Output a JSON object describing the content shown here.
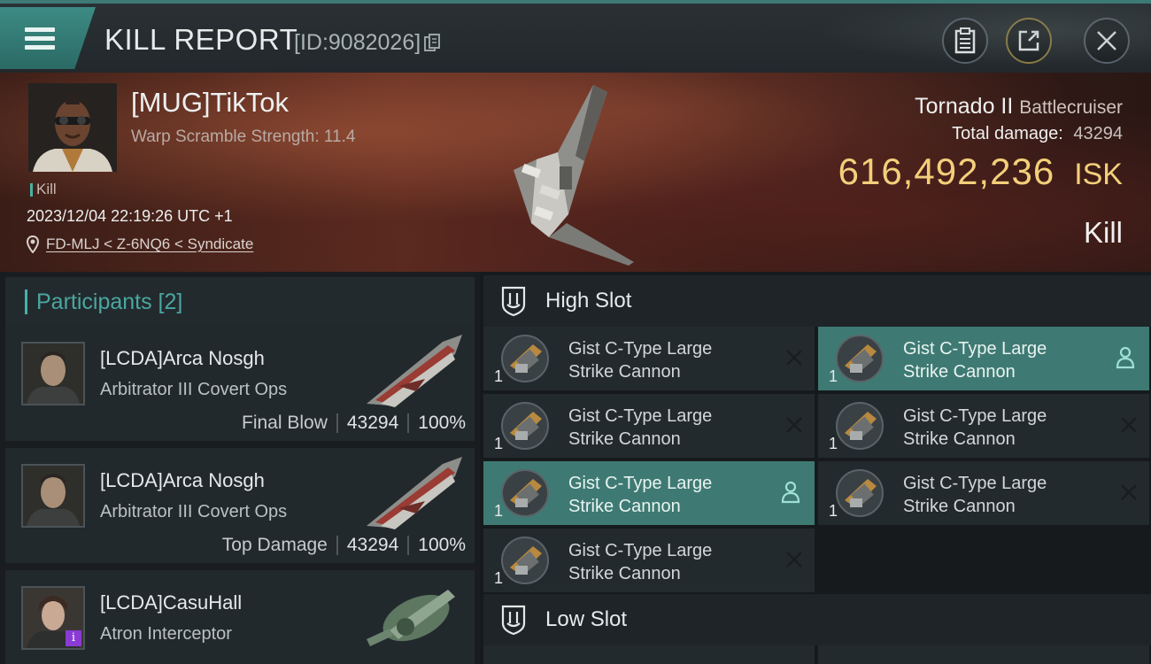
{
  "header": {
    "title": "KILL REPORT",
    "report_id": "[ID:9082026]",
    "icons": {
      "menu": "hamburger-menu-icon",
      "copy": "copy-icon",
      "clipboard": "clipboard-icon",
      "share": "share-icon",
      "close": "close-icon"
    }
  },
  "victim": {
    "name": "[MUG]TikTok",
    "subtitle": "Warp Scramble Strength: 11.4",
    "tag": "Kill",
    "timestamp": "2023/12/04 22:19:26 UTC +1",
    "location": "FD-MLJ < Z-6NQ6 < Syndicate",
    "ship_name": "Tornado II",
    "ship_class": "Battlecruiser",
    "total_damage_label": "Total damage:",
    "total_damage": "43294",
    "isk_value": "616,492,236",
    "isk_unit": "ISK",
    "result": "Kill"
  },
  "participants": {
    "label": "Participants [2]",
    "items": [
      {
        "name": "[LCDA]Arca Nosgh",
        "ship": "Arbitrator III Covert Ops",
        "role": "Final Blow",
        "damage": "43294",
        "percent": "100%"
      },
      {
        "name": "[LCDA]Arca Nosgh",
        "ship": "Arbitrator III Covert Ops",
        "role": "Top Damage",
        "damage": "43294",
        "percent": "100%"
      },
      {
        "name": "[LCDA]CasuHall",
        "ship": "Atron Interceptor",
        "badge": "i"
      }
    ]
  },
  "fitting": {
    "high_slot_label": "High Slot",
    "low_slot_label": "Low Slot",
    "modules": [
      {
        "line1": "Gist C-Type Large",
        "line2": "Strike Cannon",
        "qty": "1",
        "status": "destroyed"
      },
      {
        "line1": "Gist C-Type Large",
        "line2": "Strike Cannon",
        "qty": "1",
        "status": "dropped"
      },
      {
        "line1": "Gist C-Type Large",
        "line2": "Strike Cannon",
        "qty": "1",
        "status": "destroyed"
      },
      {
        "line1": "Gist C-Type Large",
        "line2": "Strike Cannon",
        "qty": "1",
        "status": "destroyed"
      },
      {
        "line1": "Gist C-Type Large",
        "line2": "Strike Cannon",
        "qty": "1",
        "status": "dropped"
      },
      {
        "line1": "Gist C-Type Large",
        "line2": "Strike Cannon",
        "qty": "1",
        "status": "destroyed"
      },
      {
        "line1": "Gist C-Type Large",
        "line2": "Strike Cannon",
        "qty": "1",
        "status": "destroyed"
      }
    ]
  },
  "colors": {
    "accent_teal": "#46b3a4",
    "isk_gold": "#f3cf7a",
    "highlight_row": "#3e7a73"
  }
}
